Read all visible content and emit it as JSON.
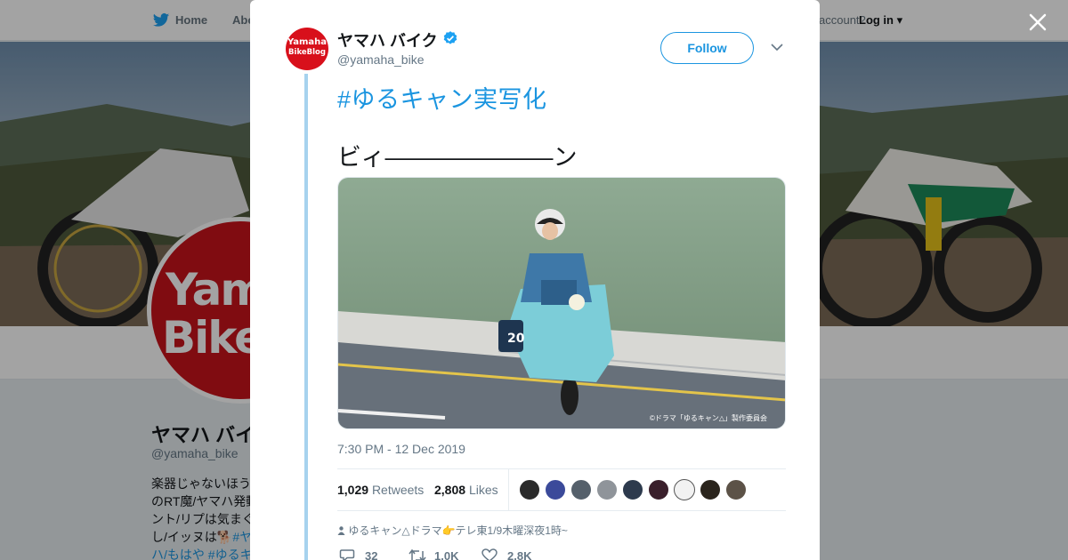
{
  "background": {
    "nav": {
      "home": "Home",
      "about": "Abo",
      "account": "account?",
      "login": "Log in"
    },
    "profile": {
      "name": "ヤマハ バイ",
      "handle": "@yamaha_bike",
      "avatar_line1": "Yama",
      "avatar_line2": "BikeBl",
      "bio": [
        {
          "text": "楽器じゃないほう",
          "link": ""
        },
        {
          "text": "のRT魔/ヤマハ発動",
          "link": ""
        },
        {
          "text": "ント/リプは気まぐ",
          "link": ""
        },
        {
          "text": "し/イッヌは🐕",
          "link": "#ヤ"
        },
        {
          "text": "ハ/もはや ",
          "link": "#ゆるキ"
        }
      ]
    }
  },
  "modal": {
    "user": {
      "name": "ヤマハ バイク",
      "handle": "@yamaha_bike",
      "avatar_line1": "Yamaha",
      "avatar_line2": "BikeBlog"
    },
    "follow_label": "Follow",
    "hashtag": "#ゆるキャン実写化",
    "text": "ビィ———————ン",
    "photo_credit": "©ドラマ「ゆるキャン△」製作委員会",
    "timestamp": "7:30 PM - 12 Dec 2019",
    "stats": {
      "retweets_count": "1,029",
      "retweets_label": "Retweets",
      "likes_count": "2,808",
      "likes_label": "Likes"
    },
    "likers": [
      {
        "color": "#2b2b2b"
      },
      {
        "color": "#3b4a9a"
      },
      {
        "color": "#55606b"
      },
      {
        "color": "#8f949a"
      },
      {
        "color": "#2d3a4d"
      },
      {
        "color": "#3a1f2b"
      },
      {
        "color": "#f2f2f2"
      },
      {
        "color": "#2a241c"
      },
      {
        "color": "#5c5247"
      }
    ],
    "source": "ゆるキャン△ドラマ👉テレ東1/9木曜深夜1時~",
    "actions": {
      "replies": "32",
      "retweets": "1.0K",
      "likes": "2.8K"
    }
  },
  "colors": {
    "brand_blue": "#1b95e0",
    "avatar_red": "#d8101b",
    "thread_line": "#a6d2ee"
  }
}
